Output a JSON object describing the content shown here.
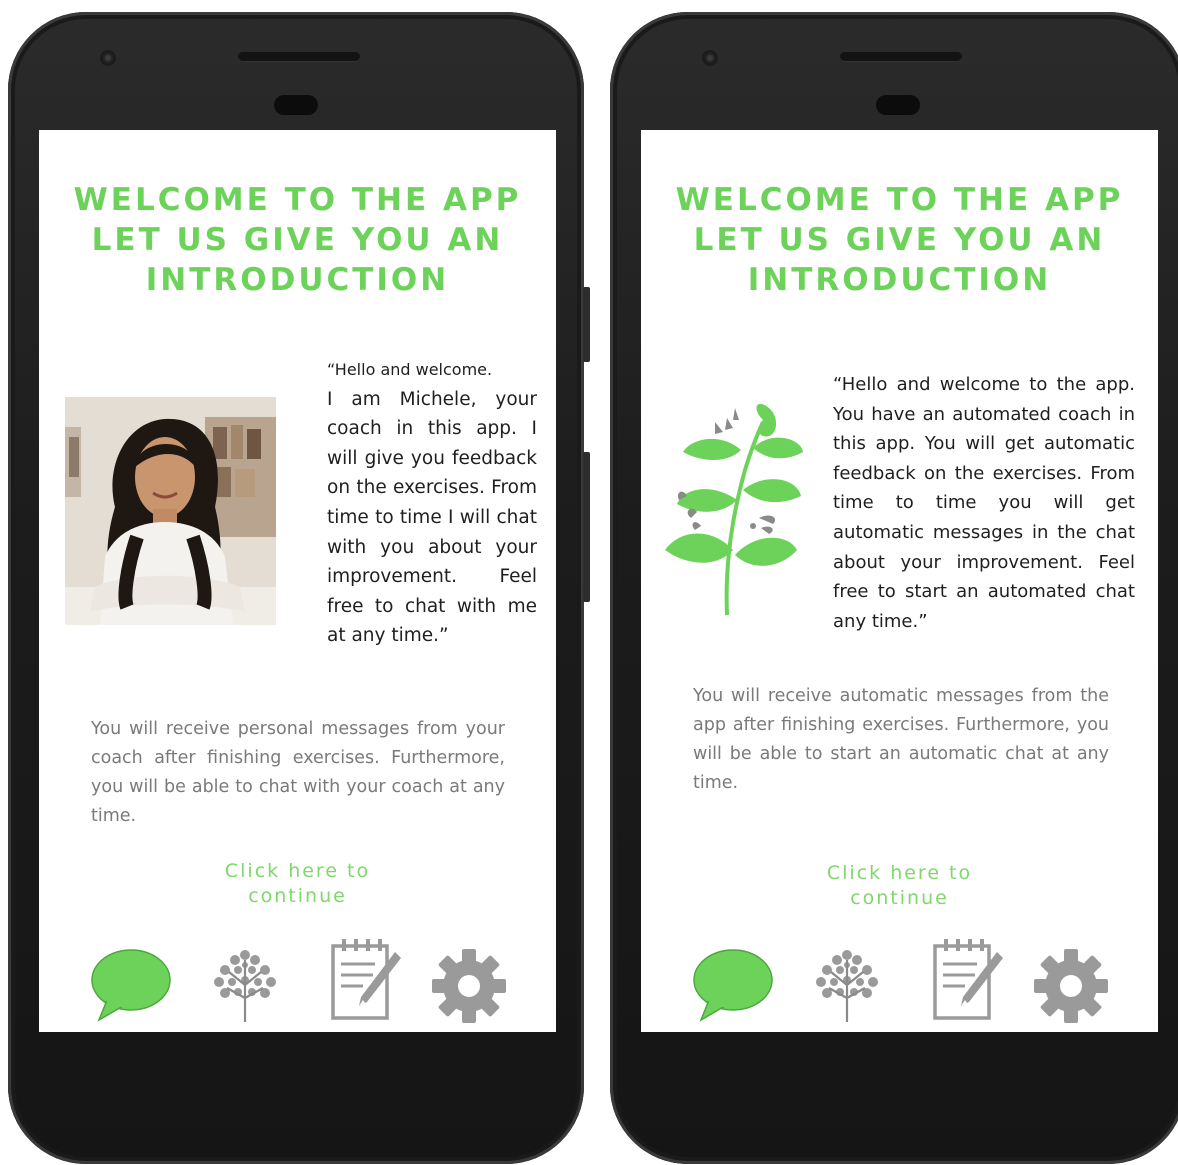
{
  "screens": [
    {
      "title_lines": [
        "WELCOME TO THE APP",
        "LET US GIVE YOU AN",
        "INTRODUCTION"
      ],
      "intro_quote_lines": [
        "“Hello and welcome.",
        "I am Michele, your coach in this app. I will give you feedback on the exercises. From time to time I will chat with you about your improvement. Feel free to chat with me at any time.”"
      ],
      "coach_photo_icon": "coach-portrait",
      "body_text": "You will receive personal messages from your coach after finishing exercises. Furthermore, you will be able to chat with your coach at any time.",
      "cta_lines": [
        "Click here to",
        "continue"
      ],
      "nav_icons": [
        "chat-bubble-icon",
        "tree-icon",
        "notepad-pencil-icon",
        "gear-icon"
      ]
    },
    {
      "title_lines": [
        "WELCOME TO THE APP",
        "LET US GIVE YOU AN",
        "INTRODUCTION"
      ],
      "intro_quote": "“Hello and welcome to the app. You have an automated coach in this app. You will get automatic feedback on the exercises. From time to time you will get automatic messages in the chat about your improvement. Feel free to start an automated chat any time.”",
      "plant_icon": "leaf-sprout-icon",
      "body_text": "You will receive automatic messages from the app after finishing exercises. Furthermore, you will be able to start an automatic chat at any time.",
      "cta_lines": [
        "Click here to",
        "continue"
      ],
      "nav_icons": [
        "chat-bubble-icon",
        "tree-icon",
        "notepad-pencil-icon",
        "gear-icon"
      ]
    }
  ],
  "colors": {
    "accent_green": "#6dd25a",
    "nav_active": "#6dd25a",
    "nav_inactive": "#9a9a9a",
    "body_text": "#7a7a7a",
    "quote_text": "#1f1f1f",
    "phone_frame": "#1c1c1c"
  }
}
